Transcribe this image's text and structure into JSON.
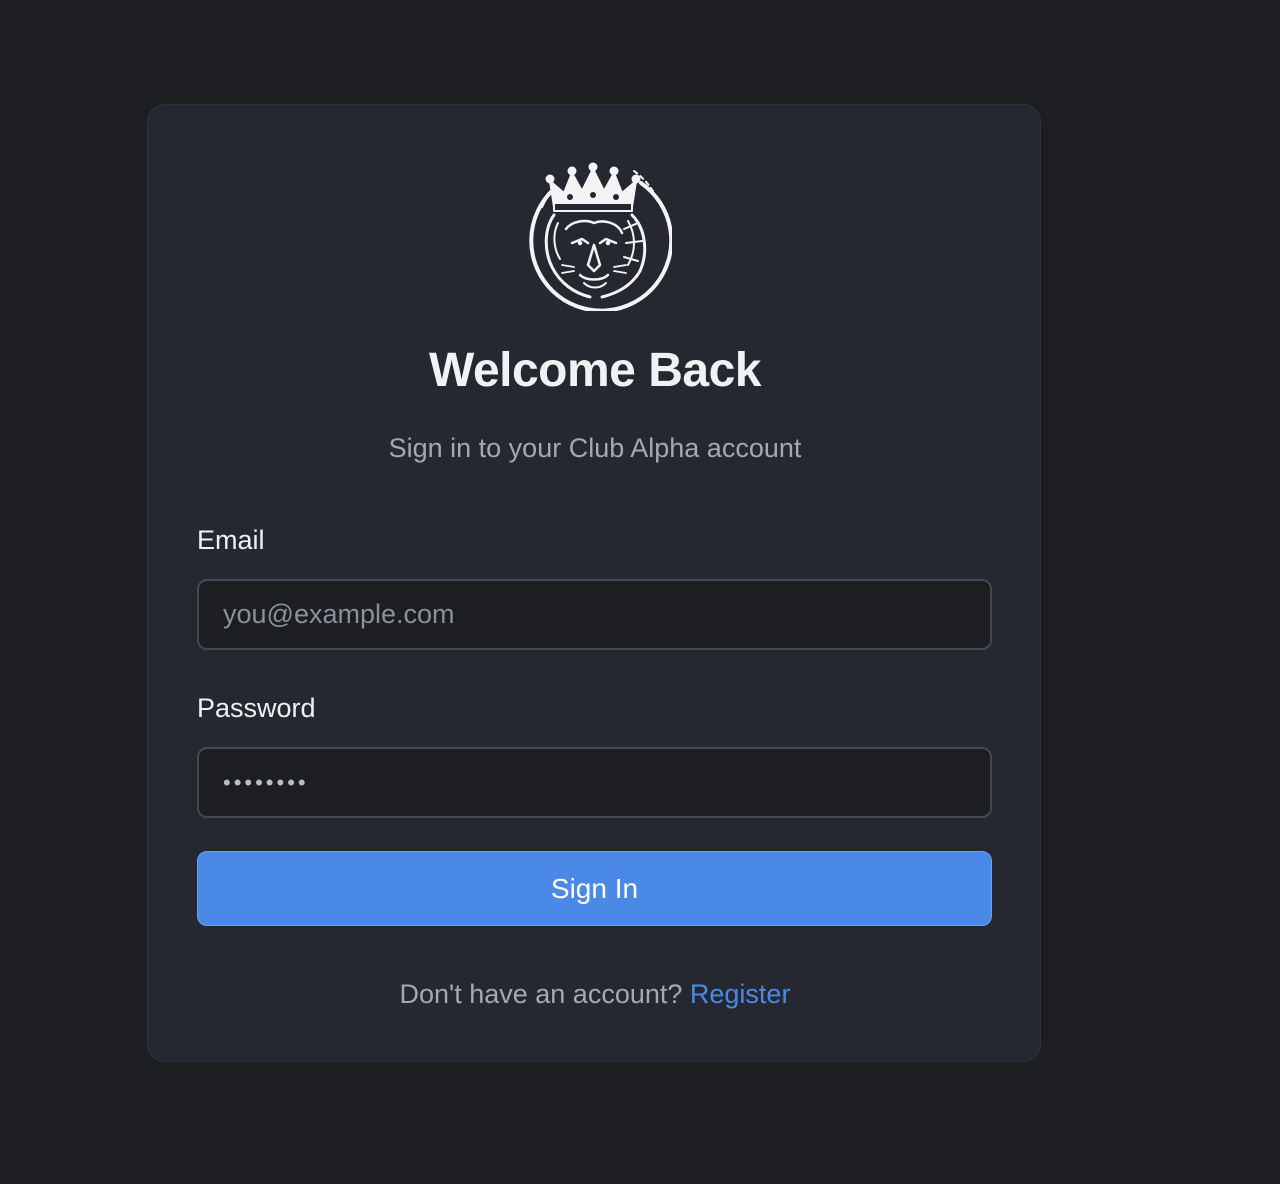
{
  "login": {
    "title": "Welcome Back",
    "subtitle": "Sign in to your Club Alpha account",
    "email_label": "Email",
    "email_placeholder": "you@example.com",
    "email_value": "",
    "password_label": "Password",
    "password_value": "12345678",
    "submit_label": "Sign In",
    "footer_text": "Don't have an account?",
    "register_link": "Register"
  },
  "logo": {
    "icon": "crowned-lion-icon"
  },
  "colors": {
    "background": "#1d1e22",
    "card": "#252830",
    "accent": "#4a8ae6"
  }
}
